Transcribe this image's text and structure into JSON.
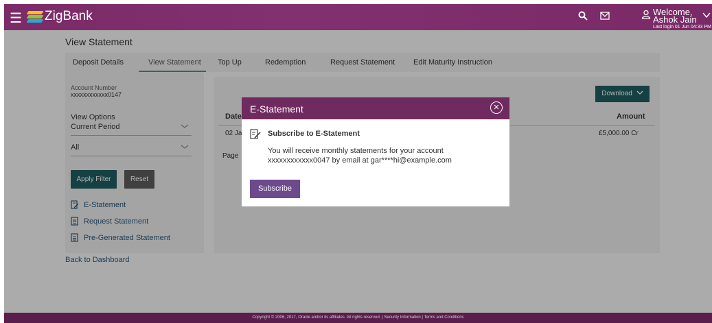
{
  "header": {
    "app_name": "ZigBank",
    "welcome": "Welcome, Ashok Jain",
    "last_login": "Last login 01 Jun 04:33 PM",
    "icons": [
      "menu-icon",
      "search-icon",
      "mail-icon",
      "user-icon",
      "chevron-down-icon"
    ]
  },
  "page_title": "View Statement",
  "tabs": [
    {
      "label": "Deposit Details"
    },
    {
      "label": "View Statement",
      "active": true
    },
    {
      "label": "Top Up"
    },
    {
      "label": "Redemption"
    },
    {
      "label": "Request Statement"
    },
    {
      "label": "Edit Maturity Instruction"
    }
  ],
  "left_panel": {
    "account_label": "Account Number",
    "account_value": "xxxxxxxxxxxx0147",
    "view_options_label": "View Options",
    "period_select": "Current Period",
    "type_select": "All",
    "apply_filter": "Apply Filter",
    "reset": "Reset",
    "links": [
      {
        "label": "E-Statement",
        "icon": "edit-document-icon"
      },
      {
        "label": "Request Statement",
        "icon": "document-icon"
      },
      {
        "label": "Pre-Generated Statement",
        "icon": "document-icon"
      }
    ]
  },
  "back_link": "Back to Dashboard",
  "statement": {
    "download": "Download",
    "col_date": "Date",
    "col_amount": "Amount",
    "row_date": "02 Ja",
    "row_amount": "£5,000.00 Cr",
    "page_label": "Page"
  },
  "modal": {
    "title": "E-Statement",
    "subtitle": "Subscribe to E-Statement",
    "text_line1": "You will receive monthly statements for your account",
    "text_line2": "xxxxxxxxxxxx0047 by email at gar****hi@example.com",
    "button": "Subscribe"
  },
  "footer": "Copyright © 2006, 2017, Oracle and/or its affiliates. All rights reserved. | Security Information | Terms and Conditions",
  "colors": {
    "header": "#7a2a66",
    "modal_header": "#6f2a5f",
    "primary_button": "#1f5e5f",
    "subscribe_button": "#6c4a8c",
    "link": "#2d5a7b",
    "footer": "#5a1e4c"
  }
}
